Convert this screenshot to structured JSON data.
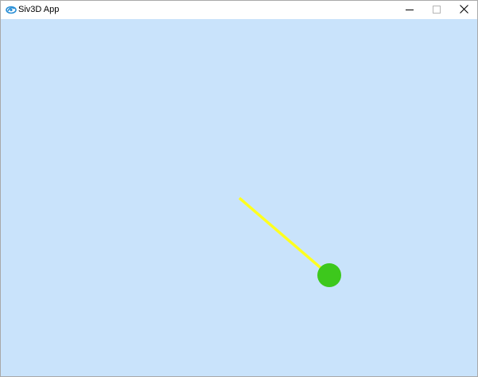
{
  "window": {
    "title": "Siv3D App",
    "icon": "siv3d-logo-icon",
    "controls": {
      "minimize_icon": "minimize-icon",
      "maximize_icon": "maximize-icon",
      "close_icon": "close-icon"
    }
  },
  "scene": {
    "background_color": "#c9e3fb",
    "line_color": "#ffff1f",
    "ball_color": "#3dc81c"
  }
}
